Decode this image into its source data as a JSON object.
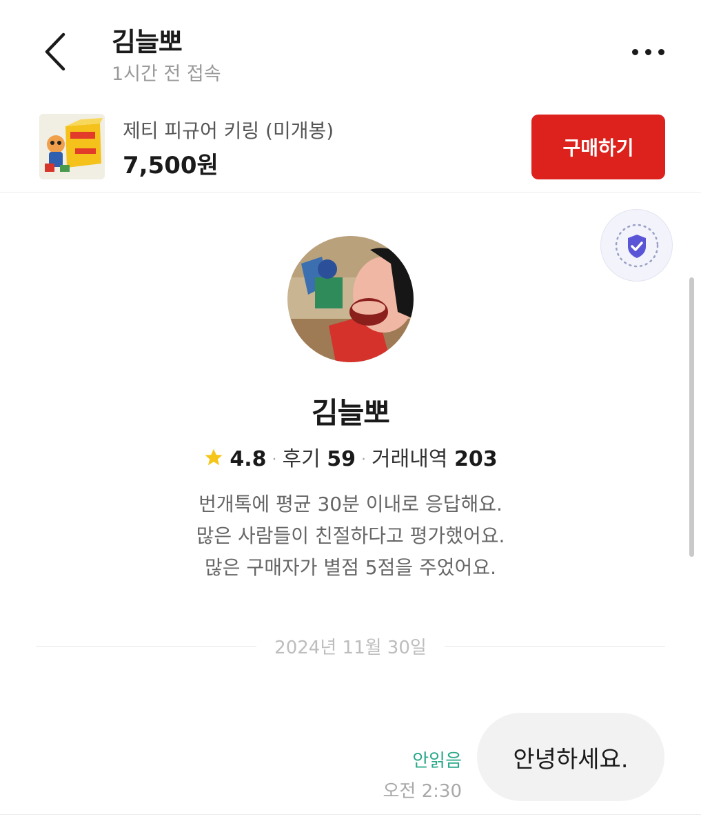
{
  "header": {
    "name": "김늘뽀",
    "status": "1시간 전 접속"
  },
  "product": {
    "title": "제티 피규어 키링 (미개봉)",
    "price": "7,500원",
    "buy_label": "구매하기"
  },
  "profile": {
    "name": "김늘뽀",
    "rating": "4.8",
    "reviews_label": "후기",
    "reviews_count": "59",
    "trades_label": "거래내역",
    "trades_count": "203",
    "intro_lines": [
      "번개톡에 평균 30분 이내로 응답해요.",
      "많은 사람들이 친절하다고 평가했어요.",
      "많은 구매자가 별점 5점을 주었어요."
    ]
  },
  "chat": {
    "date": "2024년 11월 30일",
    "messages": [
      {
        "text": "안녕하세요.",
        "read_status": "안읽음",
        "time": "오전 2:30"
      }
    ]
  },
  "colors": {
    "buy_button": "#dd211c",
    "read_status": "#2aa88a",
    "badge": "#5a55d6",
    "star": "#f5c518"
  },
  "icons": [
    "back-arrow-icon",
    "more-icon",
    "shield-check-icon",
    "star-icon"
  ]
}
